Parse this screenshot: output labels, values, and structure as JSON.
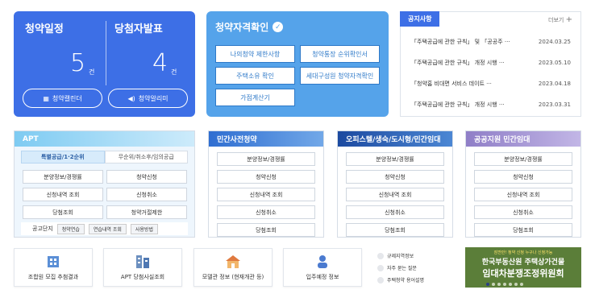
{
  "schedule": {
    "title_left": "청약일정",
    "title_right": "당첨자발표",
    "count_left": "5",
    "count_right": "4",
    "unit": "건",
    "btn_calendar": "청약캘린더",
    "btn_alert": "청약알리미"
  },
  "qualification": {
    "title": "청약자격확인",
    "buttons": [
      "나의청약 제한사항",
      "청약통장 순위확인서",
      "주택소유 확인",
      "세대구성원 청약자격확인",
      "가점계산기"
    ]
  },
  "notices": {
    "tab": "공지사항",
    "more": "더보기",
    "items": [
      {
        "title": "「주택공급에 관한 규칙」 및 「공공주 ···",
        "date": "2024.03.25"
      },
      {
        "title": "「주택공급에 관한 규칙」 개정 시행 ···",
        "date": "2023.05.10"
      },
      {
        "title": "「청약홈 비대면 서비스 데이트 ···",
        "date": "2023.04.18"
      },
      {
        "title": "「주택공급에 관한 규칙」 개정 시행 ···",
        "date": "2023.03.31"
      }
    ]
  },
  "apt": {
    "title": "APT",
    "tab_special": "특별공급/1·2순위",
    "tab_other": "무순위/취소후/임의공급",
    "buttons": [
      "분양정보/경쟁률",
      "청약신청",
      "신청내역 조회",
      "신청취소",
      "당첨조회",
      "청약거절제한"
    ],
    "foot_label": "공고단지",
    "foot_chips": [
      "청약연습",
      "연습내역 조회",
      "사용방법"
    ]
  },
  "presale": {
    "title": "민간사전청약",
    "buttons": [
      "분양정보/경쟁률",
      "청약신청",
      "신청내역 조회",
      "신청취소",
      "당첨조회"
    ]
  },
  "officetel": {
    "title": "오피스텔/생숙/도시형/민간임대",
    "buttons": [
      "분양정보/경쟁률",
      "청약신청",
      "신청내역 조회",
      "신청취소",
      "당첨조회"
    ]
  },
  "public_rental": {
    "title": "공공지원 민간임대",
    "buttons": [
      "분양정보/경쟁률",
      "청약신청",
      "신청내역 조회",
      "신청취소",
      "당첨조회"
    ]
  },
  "bottom": {
    "cards": [
      "조합원 모집 추첨결과",
      "APT 당첨사실조회",
      "모델관 정보 (현재개관 등)",
      "입주예정 정보"
    ],
    "list": [
      "규제지역정보",
      "자주 묻는 질문",
      "주택청약 용어설명"
    ],
    "banner_small": "잠깐만! 청약 신청 누구나 신청가능",
    "banner_line1": "한국부동산원 주택상가건물",
    "banner_line2": "임대차분쟁조정위원회"
  },
  "colors": {
    "primary": "#3d6fe6",
    "qual_bg": "#55a3ea",
    "banner_bg": "#5b7e39"
  }
}
